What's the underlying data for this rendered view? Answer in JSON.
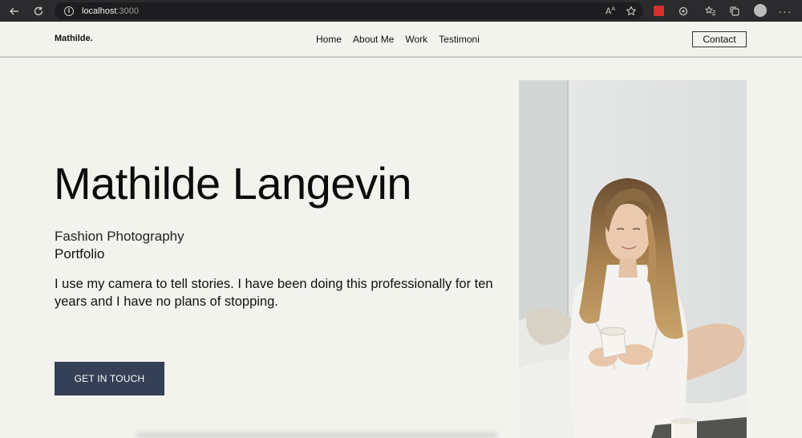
{
  "browser": {
    "url_host": "localhost",
    "url_port": ":3000"
  },
  "header": {
    "logo": "Mathilde.",
    "nav": [
      "Home",
      "About Me",
      "Work",
      "Testimoni"
    ],
    "contact_label": "Contact"
  },
  "hero": {
    "title": "Mathilde Langevin",
    "subtitle": "Fashion Photography",
    "subtitle2": "Portfolio",
    "description": "I use my camera to tell stories. I have been doing this professionally for ten years and I have no plans of stopping.",
    "cta_label": "GET IN TOUCH"
  },
  "colors": {
    "background": "#f2f3ed",
    "cta": "#353f55",
    "browser_bar": "#2b2b2d"
  },
  "icons": [
    "back-arrow-icon",
    "reload-icon",
    "info-icon",
    "read-aloud-icon",
    "favorite-add-icon",
    "extension-icon",
    "puzzle-icon",
    "favorites-icon",
    "collections-icon",
    "profile-icon",
    "more-icon"
  ]
}
